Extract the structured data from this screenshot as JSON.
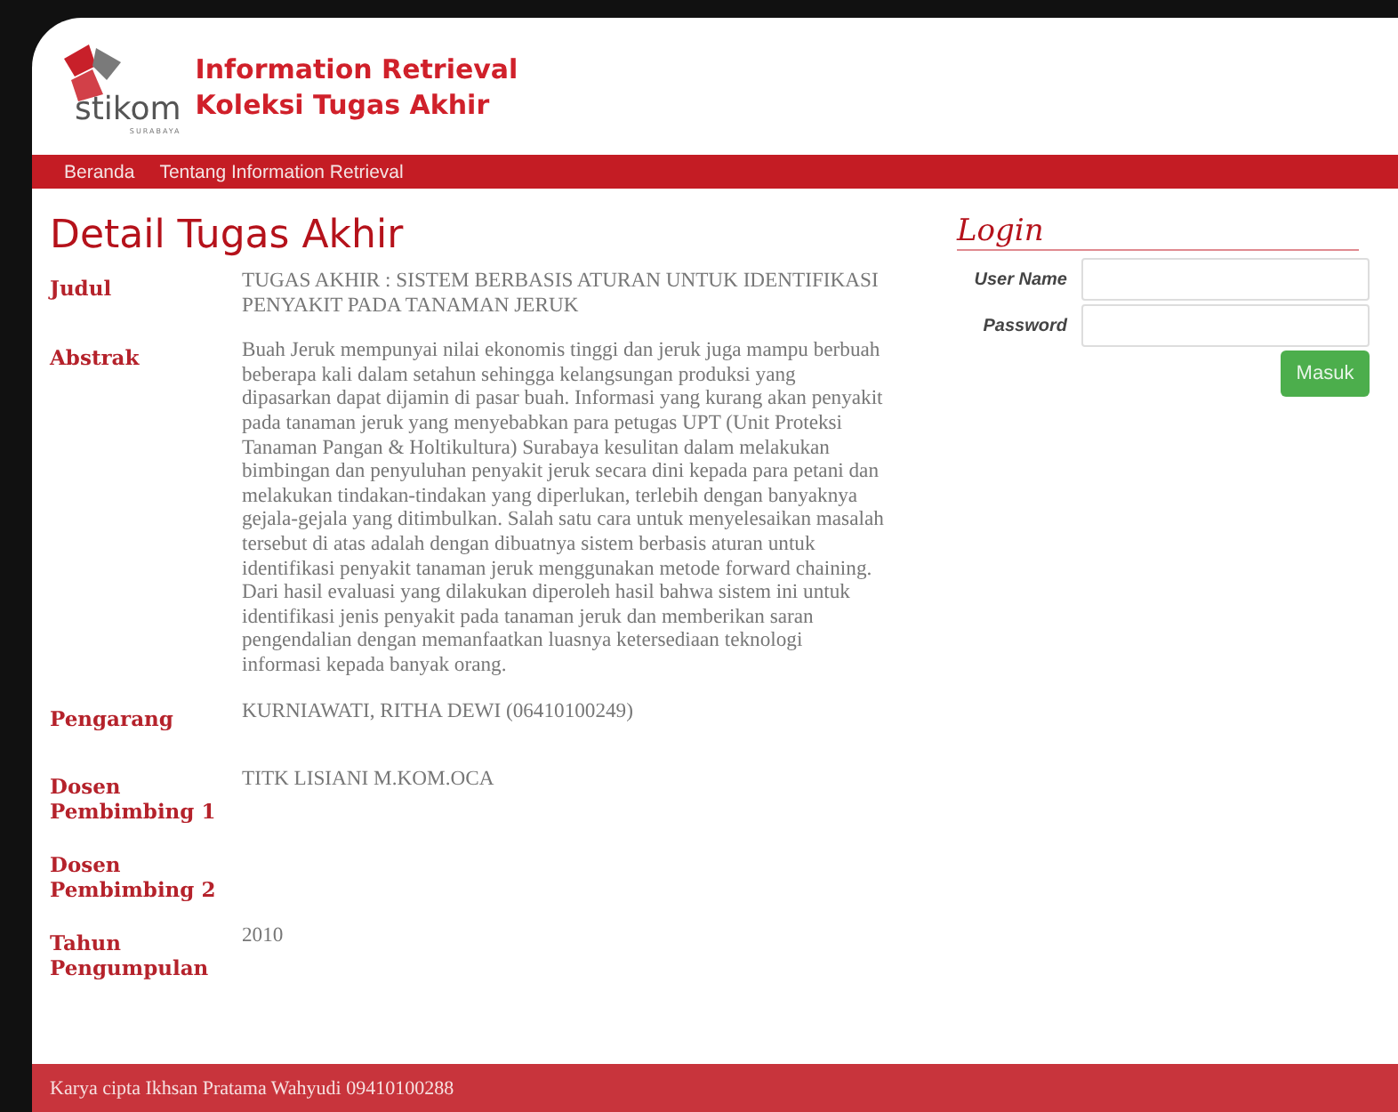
{
  "header": {
    "logo_word": "stikom",
    "logo_sub": "SURABAYA",
    "title_line_1": "Information Retrieval",
    "title_line_2": "Koleksi Tugas Akhir"
  },
  "nav": [
    {
      "label": "Beranda"
    },
    {
      "label": "Tentang Information Retrieval"
    }
  ],
  "detail": {
    "heading": "Detail Tugas Akhir",
    "fields": [
      {
        "label": "Judul",
        "value": "TUGAS AKHIR : SISTEM BERBASIS ATURAN UNTUK IDENTIFIKASI PENYAKIT PADA TANAMAN JERUK"
      },
      {
        "label": "Abstrak",
        "value": "Buah Jeruk mempunyai nilai ekonomis tinggi dan jeruk juga mampu berbuah beberapa kali dalam setahun sehingga kelangsungan produksi yang dipasarkan dapat dijamin di pasar buah. Informasi yang kurang akan penyakit pada tanaman jeruk yang menyebabkan para petugas UPT (Unit Proteksi Tanaman Pangan & Holtikultura) Surabaya kesulitan dalam melakukan bimbingan dan penyuluhan penyakit jeruk secara dini kepada para petani dan melakukan tindakan-tindakan yang diperlukan, terlebih dengan banyaknya gejala-gejala yang ditimbulkan. Salah satu cara untuk menyelesaikan masalah tersebut di atas adalah dengan dibuatnya sistem berbasis aturan untuk identifikasi penyakit tanaman jeruk menggunakan metode forward chaining. Dari hasil evaluasi yang dilakukan diperoleh hasil bahwa sistem ini untuk identifikasi jenis penyakit pada tanaman jeruk dan memberikan saran pengendalian dengan memanfaatkan luasnya ketersediaan teknologi informasi kepada banyak orang."
      },
      {
        "label": "Pengarang",
        "value": "KURNIAWATI, RITHA DEWI (06410100249)"
      },
      {
        "label": "Dosen Pembimbing 1",
        "value": "TITK LISIANI M.KOM.OCA"
      },
      {
        "label": "Dosen Pembimbing 2"
      },
      {
        "label": "Tahun Pengumpulan",
        "value": "2010"
      }
    ]
  },
  "login": {
    "title": "Login",
    "fields": [
      {
        "label": "User Name"
      },
      {
        "label": "Password"
      }
    ],
    "button": "Masuk"
  },
  "footer": "Karya cipta Ikhsan Pratama Wahyudi 09410100288"
}
